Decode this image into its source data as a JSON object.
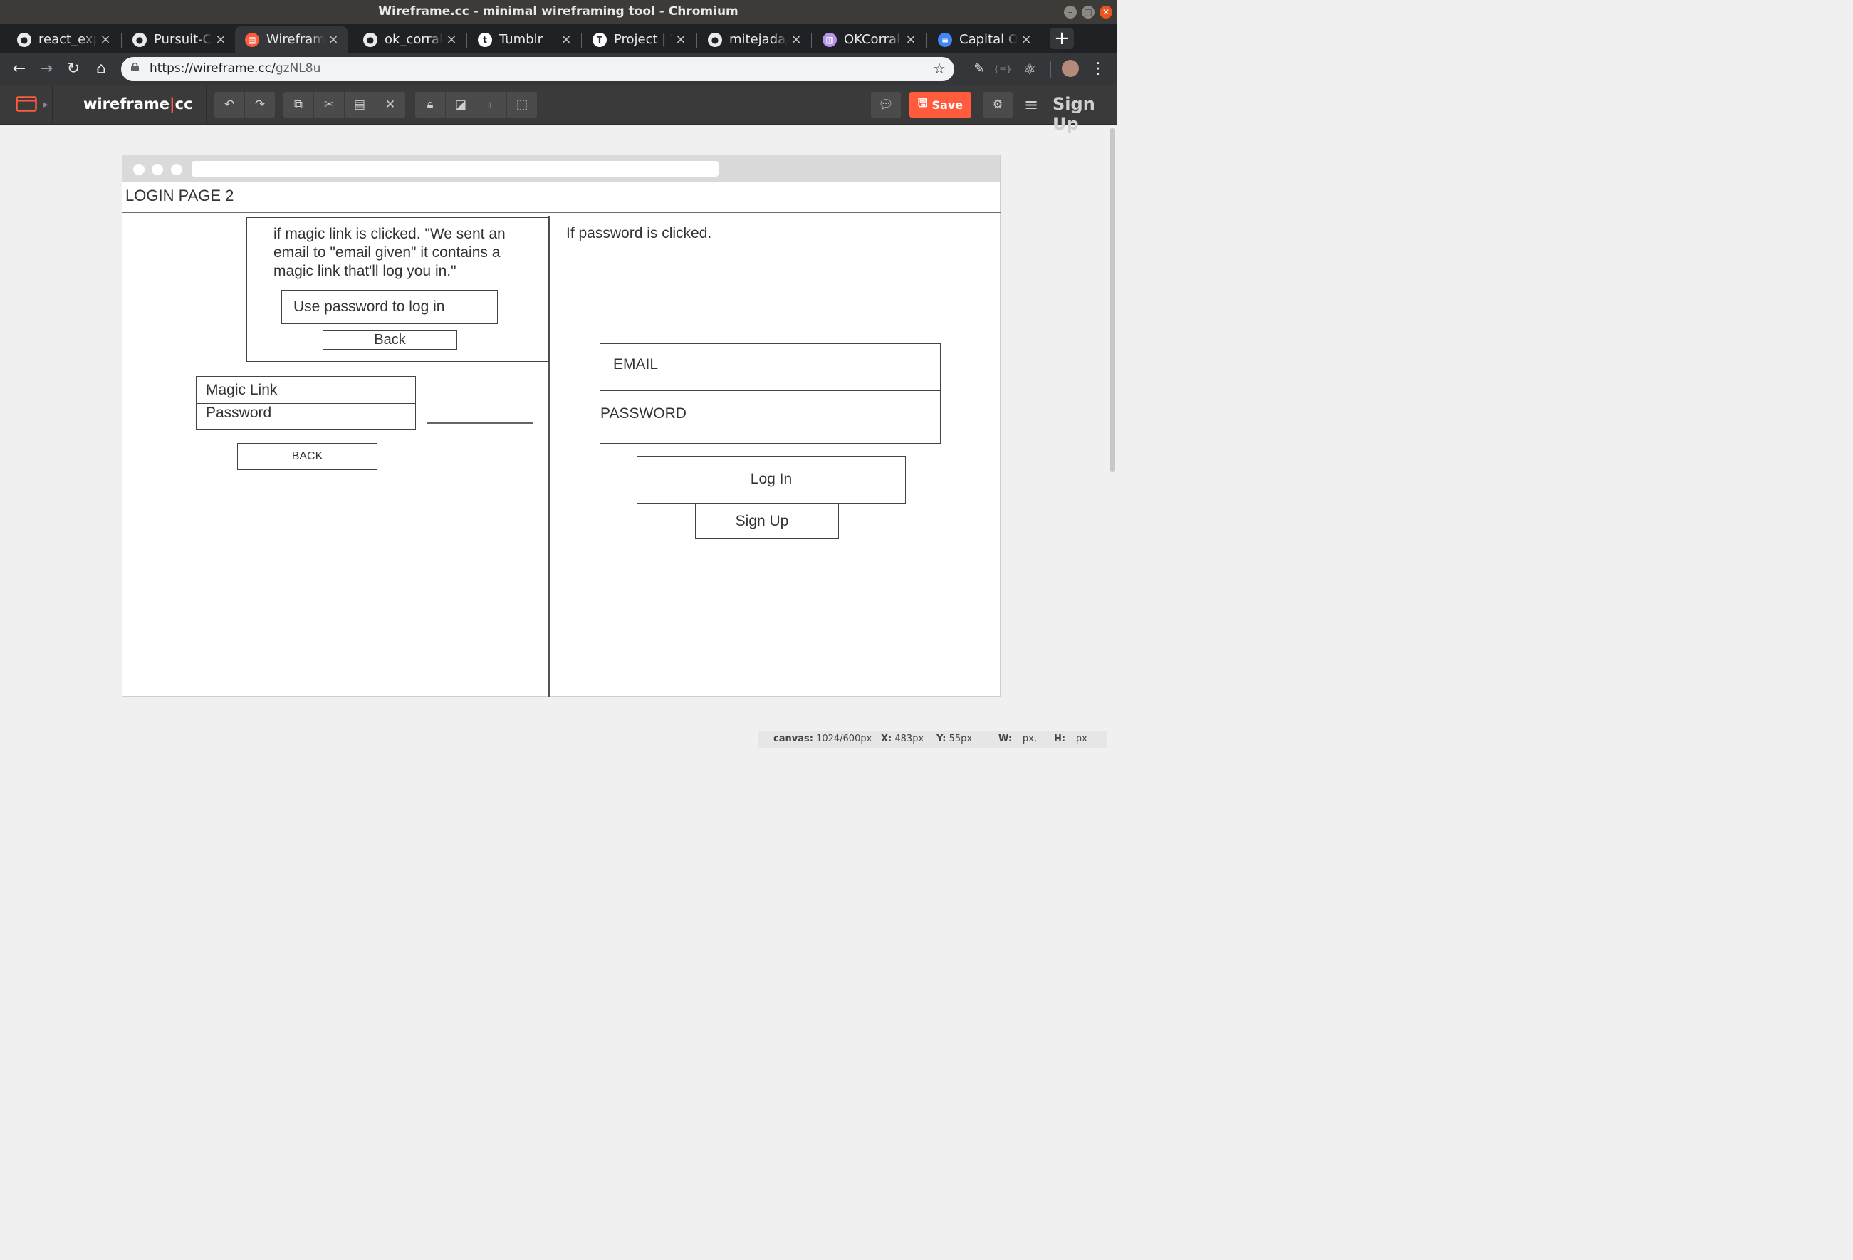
{
  "os": {
    "window_title": "Wireframe.cc - minimal wireframing tool - Chromium"
  },
  "tabs": [
    {
      "label": "react_exp",
      "icon": "github-icon"
    },
    {
      "label": "Pursuit-Co",
      "icon": "github-icon"
    },
    {
      "label": "Wireframe",
      "icon": "wireframe-icon",
      "active": true
    },
    {
      "label": "ok_corral/",
      "icon": "github-icon"
    },
    {
      "label": "Tumblr",
      "icon": "tumblr-icon"
    },
    {
      "label": "Project | T",
      "icon": "pivotal-tracker-icon"
    },
    {
      "label": "mitejada/",
      "icon": "github-icon"
    },
    {
      "label": "OKCorral |",
      "icon": "trello-icon"
    },
    {
      "label": "Capital On",
      "icon": "google-docs-icon"
    }
  ],
  "browser": {
    "url_host": "https://wireframe.cc/",
    "url_path": "gzNL8u"
  },
  "app": {
    "logo_left": "wireframe",
    "logo_divider": "|",
    "logo_right": "cc",
    "save_label": "Save",
    "signup_label": "Sign Up",
    "accent_color": "#ff5b3c"
  },
  "canvas": {
    "page_title": "LOGIN PAGE 2",
    "magic_note": "if magic link is clicked. \"We sent an email to \"email given\" it contains a magic link that'll log you in.\"",
    "use_password_btn": "Use password to log in",
    "back_small_btn": "Back",
    "option_magic": "Magic Link",
    "option_password": "Password",
    "back_caps_btn": "BACK",
    "password_note": "If password is clicked.",
    "email_field": "EMAIL",
    "password_field": "PASSWORD",
    "login_btn": "Log In",
    "signup_btn": "Sign Up"
  },
  "status": {
    "canvas_label": "canvas:",
    "canvas_value": "1024/600px",
    "x_label": "X:",
    "x_value": "483px",
    "y_label": "Y:",
    "y_value": "55px",
    "w_label": "W:",
    "w_value": "– px,",
    "h_label": "H:",
    "h_value": "– px"
  }
}
